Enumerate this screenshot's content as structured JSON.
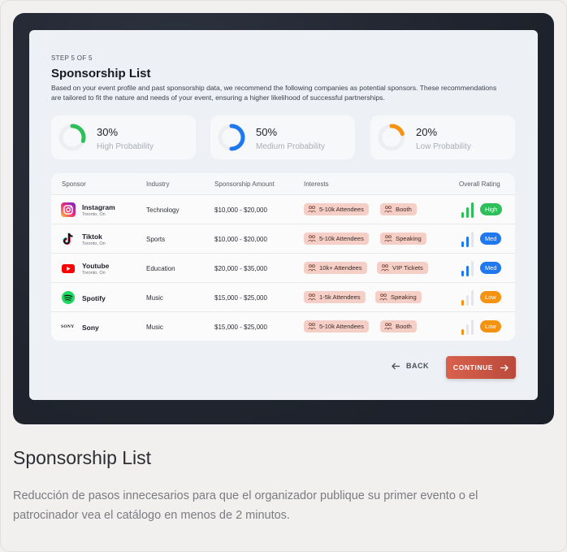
{
  "step": "STEP 5 OF 5",
  "title": "Sponsorship List",
  "description": "Based on your event profile and past sponsorship data, we recommend the following companies as potential sponsors. These recommendations are tailored to fit the nature and needs of your event, ensuring a higher likelihood of successful partnerships.",
  "probabilities": [
    {
      "pct": "30%",
      "label": "High Probability",
      "value": 0.3,
      "color": "#2fbf5a"
    },
    {
      "pct": "50%",
      "label": "Medium Probability",
      "value": 0.5,
      "color": "#1f78ef"
    },
    {
      "pct": "20%",
      "label": "Low Probability",
      "value": 0.2,
      "color": "#f5920f"
    }
  ],
  "table": {
    "headers": {
      "sponsor": "Sponsor",
      "industry": "Industry",
      "amount": "Sponsorship Amount",
      "interests": "Interests",
      "rating": "Overall Rating"
    },
    "rows": [
      {
        "name": "Instagram",
        "location": "Toronto, On",
        "industry": "Technology",
        "amount": "$10,000 - $20,000",
        "interests": [
          "5-10k Attendees",
          "Booth"
        ],
        "rating": "High",
        "level": 3
      },
      {
        "name": "Tiktok",
        "location": "Toronto, On",
        "industry": "Sports",
        "amount": "$10,000 - $20,000",
        "interests": [
          "5-10k Attendees",
          "Speaking"
        ],
        "rating": "Med",
        "level": 2
      },
      {
        "name": "Youtube",
        "location": "Toronto, On",
        "industry": "Education",
        "amount": "$20,000 - $35,000",
        "interests": [
          "10k+ Attendees",
          "VIP Tickets"
        ],
        "rating": "Med",
        "level": 2
      },
      {
        "name": "Spotify",
        "location": "",
        "industry": "Music",
        "amount": "$15,000 - $25,000",
        "interests": [
          "1-5k Attendees",
          "Speaking"
        ],
        "rating": "Low",
        "level": 1
      },
      {
        "name": "Sony",
        "location": "",
        "industry": "Music",
        "amount": "$15,000 - $25,000",
        "interests": [
          "5-10k Attendees",
          "Booth"
        ],
        "rating": "Low",
        "level": 1
      }
    ],
    "sony_logo_text": "SONY"
  },
  "rating_colors": {
    "High": "#2fbf5a",
    "Med": "#1f78ef",
    "Low": "#f5920f"
  },
  "buttons": {
    "back": "BACK",
    "continue": "CONTINUE"
  },
  "caption": {
    "title": "Sponsorship List",
    "text": "Reducción de pasos innecesarios para que el organizador publique su primer evento o el patrocinador vea el catálogo en menos de 2 minutos."
  }
}
